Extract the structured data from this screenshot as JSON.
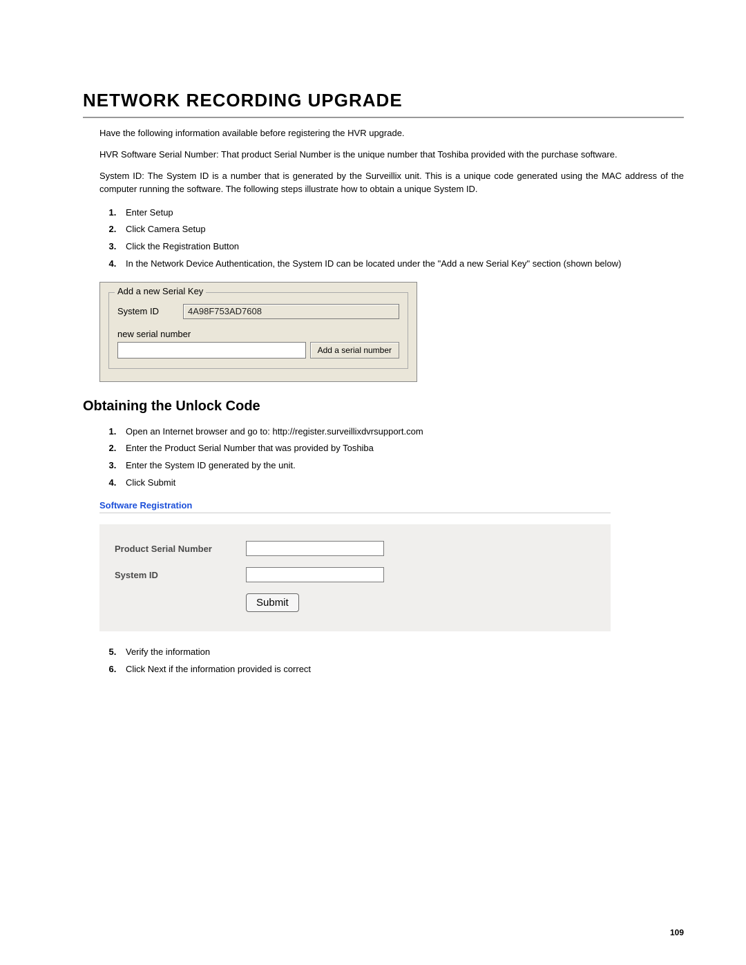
{
  "page": {
    "title": "NETWORK RECORDING UPGRADE",
    "intro1": "Have the following information available before registering the HVR upgrade.",
    "intro2": "HVR Software Serial Number: That product Serial Number is the unique number that Toshiba provided with the purchase software.",
    "intro3": "System ID: The System ID is a number that is generated by the Surveillix unit. This is a unique code generated using the MAC address of the computer running the software. The following steps illustrate how to obtain a unique System ID.",
    "steps_a": [
      "Enter Setup",
      "Click Camera Setup",
      "Click the Registration Button",
      "In the Network Device Authentication, the System ID can be located under the \"Add a new Serial Key\" section (shown below)"
    ],
    "subheading": "Obtaining the Unlock Code",
    "steps_b": [
      "Open an Internet browser and go to: http://register.surveillixdvrsupport.com",
      "Enter the Product Serial Number that was provided by Toshiba",
      "Enter the System ID generated by the unit.",
      "Click Submit"
    ],
    "steps_c": [
      "Verify the information",
      "Click Next if the information provided is correct"
    ],
    "page_number": "109"
  },
  "dialog1": {
    "legend": "Add a new Serial Key",
    "system_id_label": "System ID",
    "system_id_value": "4A98F753AD7608",
    "new_serial_label": "new serial number",
    "new_serial_value": "",
    "add_button": "Add a serial number"
  },
  "webform": {
    "title": "Software Registration",
    "product_serial_label": "Product Serial Number",
    "product_serial_value": "",
    "system_id_label": "System ID",
    "system_id_value": "",
    "submit_label": "Submit"
  }
}
